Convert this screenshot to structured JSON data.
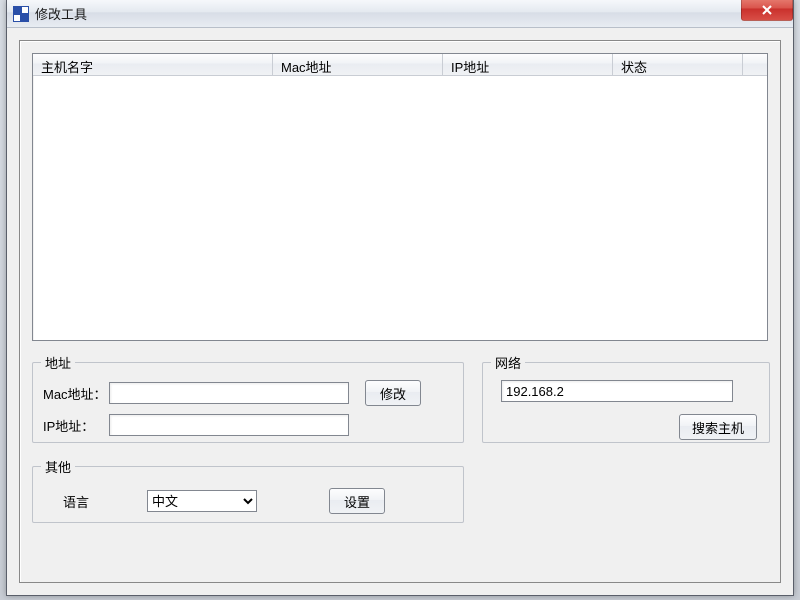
{
  "window": {
    "title": "修改工具"
  },
  "columns": {
    "hostname": "主机名字",
    "mac": "Mac地址",
    "ip": "IP地址",
    "status": "状态"
  },
  "rows": [],
  "address": {
    "legend": "地址",
    "mac_label": "Mac地址：",
    "mac_value": "",
    "ip_label": "IP地址：",
    "ip_value": "",
    "modify_btn": "修改"
  },
  "network": {
    "legend": "网络",
    "subnet_value": "192.168.2",
    "search_btn": "搜索主机"
  },
  "other": {
    "legend": "其他",
    "lang_label": "语言",
    "lang_value": "中文",
    "settings_btn": "设置"
  }
}
